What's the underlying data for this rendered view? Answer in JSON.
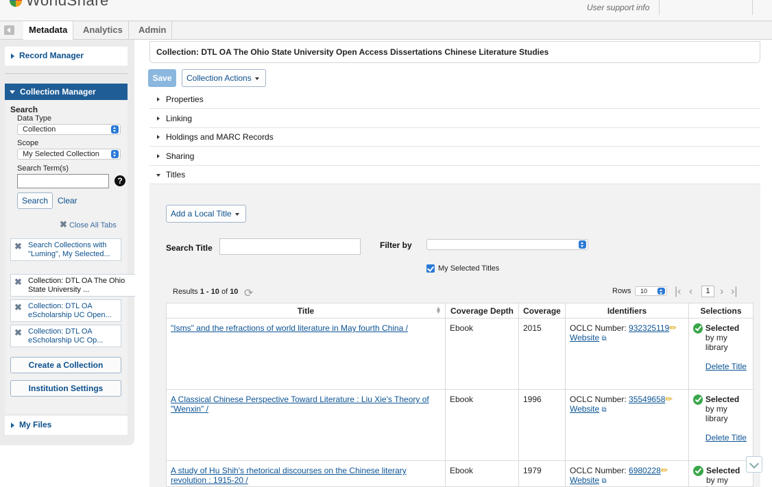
{
  "header": {
    "brand": "WorldShare",
    "support": "User support info"
  },
  "tabs": [
    {
      "label": "Metadata"
    },
    {
      "label": "Analytics"
    },
    {
      "label": "Admin"
    }
  ],
  "sidebar": {
    "record_manager": "Record Manager",
    "collection_manager": "Collection Manager",
    "search_heading": "Search",
    "data_type_label": "Data Type",
    "data_type_value": "Collection",
    "scope_label": "Scope",
    "scope_value": "My Selected Collection",
    "search_terms_label": "Search Term(s)",
    "search_terms_value": "",
    "help": "?",
    "search_btn": "Search",
    "clear_btn": "Clear",
    "close_all_tabs": "Close All Tabs",
    "open_tabs": [
      {
        "label": "Search Collections with \"Luming\", My Selected..."
      },
      {
        "label": "Collection: DTL OA The Ohio State University ..."
      },
      {
        "label": "Collection: DTL OA eScholarship UC Open..."
      },
      {
        "label": "Collection: DTL OA eScholarship UC Op..."
      }
    ],
    "create_collection": "Create a Collection",
    "institution_settings": "Institution Settings",
    "my_files": "My Files"
  },
  "main": {
    "collection_title": "Collection: DTL OA The Ohio State University Open Access Dissertations Chinese Literature Studies",
    "save": "Save",
    "collection_actions": "Collection Actions",
    "sections": [
      {
        "label": "Properties"
      },
      {
        "label": "Linking"
      },
      {
        "label": "Holdings and MARC Records"
      },
      {
        "label": "Sharing"
      },
      {
        "label": "Titles"
      }
    ],
    "add_local_title": "Add a Local Title",
    "search_title_label": "Search Title",
    "search_title_value": "",
    "filter_by_label": "Filter by",
    "filter_by_value": "",
    "my_selected_titles": "My Selected Titles",
    "results_prefix": "Results ",
    "results_range": "1 - 10",
    "results_of": " of ",
    "results_total": "10",
    "rows_label": "Rows",
    "rows_value": "10",
    "page": "1"
  },
  "table": {
    "columns": [
      "Title",
      "Coverage Depth",
      "Coverage",
      "Identifiers",
      "Selections"
    ],
    "rows": [
      {
        "title": "\"Isms\" and the refractions of world literature in May fourth China /",
        "depth": "Ebook",
        "coverage": "2015",
        "oclc_label": "OCLC Number: ",
        "oclc": "932325119",
        "website": "Website",
        "selected": "Selected",
        "selected_by": "by my library",
        "delete": "Delete Title"
      },
      {
        "title": "A Classical Chinese Perspective Toward Literature : Liu Xie's Theory of \"Wenxin\" /",
        "depth": "Ebook",
        "coverage": "1996",
        "oclc_label": "OCLC Number: ",
        "oclc": "35549658",
        "website": "Website",
        "selected": "Selected",
        "selected_by": "by my library",
        "delete": "Delete Title"
      },
      {
        "title": "A study of Hu Shih's rhetorical discourses on the Chinese literary revolution : 1915-20 /",
        "depth": "Ebook",
        "coverage": "1979",
        "oclc_label": "OCLC Number: ",
        "oclc": "6980228",
        "website": "Website",
        "selected": "Selected",
        "selected_by": "by my",
        "delete": ""
      }
    ]
  },
  "colors": {
    "brand_blue": "#1f5d97",
    "link": "#0b5394",
    "save_disabled": "#8bb7de",
    "selected_green": "#3aa64a"
  }
}
